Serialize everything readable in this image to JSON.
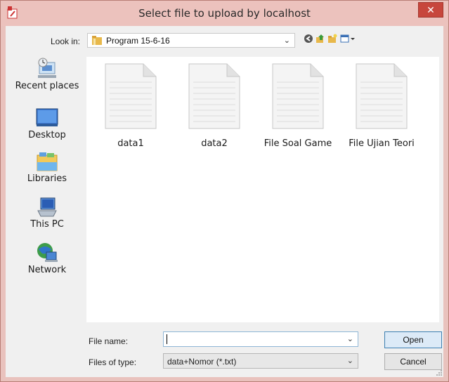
{
  "window": {
    "title": "Select file to upload by localhost",
    "close_glyph": "✕"
  },
  "toolbar": {
    "lookin_label": "Look in:",
    "lookin_value": "Program 15-6-16",
    "dropdown_glyph": "⌄",
    "icons": [
      "back-icon",
      "up-folder-icon",
      "new-folder-icon",
      "view-menu-icon"
    ]
  },
  "sidebar": {
    "items": [
      {
        "label": "Recent places",
        "icon": "recent-places-icon"
      },
      {
        "label": "Desktop",
        "icon": "desktop-icon"
      },
      {
        "label": "Libraries",
        "icon": "libraries-icon"
      },
      {
        "label": "This PC",
        "icon": "this-pc-icon"
      },
      {
        "label": "Network",
        "icon": "network-icon"
      }
    ]
  },
  "files": [
    {
      "name": "data1",
      "icon": "text-file-icon"
    },
    {
      "name": "data2",
      "icon": "text-file-icon"
    },
    {
      "name": "File Soal Game",
      "icon": "text-file-icon"
    },
    {
      "name": "File Ujian Teori",
      "icon": "text-file-icon"
    }
  ],
  "form": {
    "filename_label": "File name:",
    "filename_value": "",
    "filetype_label": "Files of type:",
    "filetype_value": "data+Nomor (*.txt)",
    "open_label": "Open",
    "cancel_label": "Cancel"
  },
  "colors": {
    "titlebar": "#ecc2bd",
    "close_button": "#c7463c",
    "selection_border": "#3c7fb1"
  }
}
